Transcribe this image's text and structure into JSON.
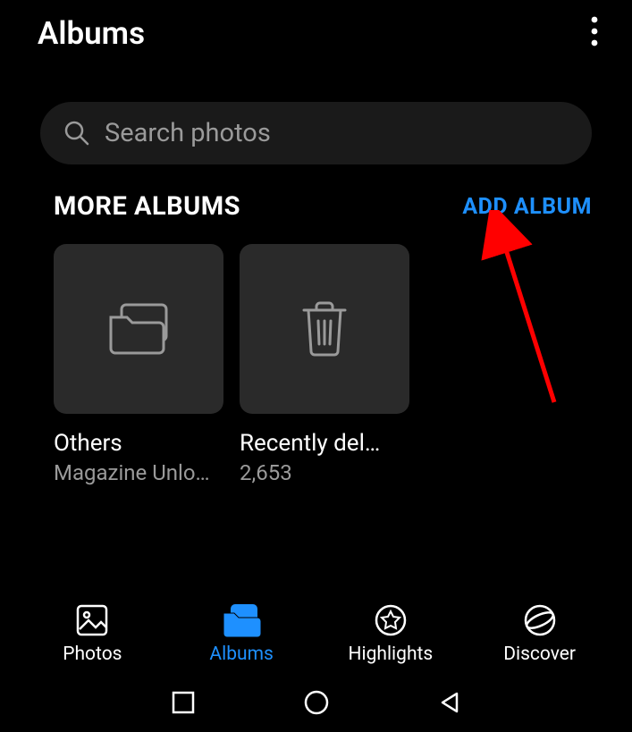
{
  "header": {
    "title": "Albums"
  },
  "search": {
    "placeholder": "Search photos"
  },
  "section": {
    "title": "MORE ALBUMS",
    "add_label": "ADD ALBUM"
  },
  "albums": [
    {
      "title": "Others",
      "subtitle": "Magazine Unlo…",
      "icon": "folder"
    },
    {
      "title": "Recently del…",
      "subtitle": "2,653",
      "icon": "trash"
    }
  ],
  "nav": {
    "items": [
      {
        "label": "Photos"
      },
      {
        "label": "Albums"
      },
      {
        "label": "Highlights"
      },
      {
        "label": "Discover"
      }
    ],
    "active_index": 1
  },
  "accent_color": "#1e90ff"
}
